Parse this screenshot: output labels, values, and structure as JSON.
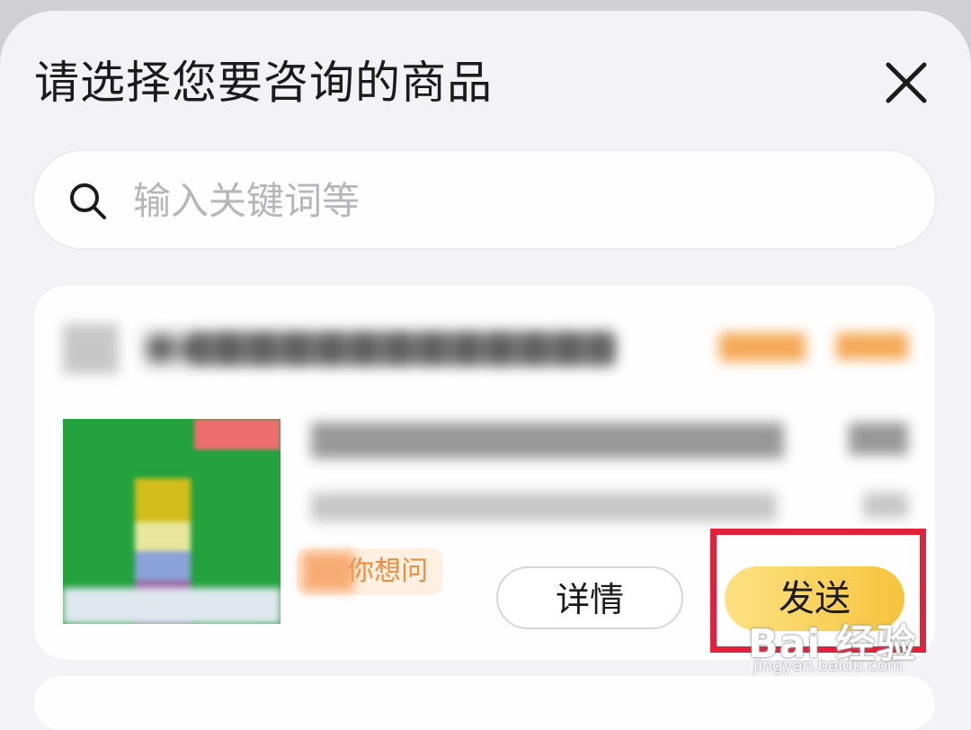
{
  "dialog": {
    "title": "请选择您要咨询的商品",
    "close_icon": "close-icon"
  },
  "search": {
    "placeholder": "输入关键词等",
    "value": "",
    "icon": "search-icon"
  },
  "product_card": {
    "want_ask_tag": "你想问",
    "detail_button": "详情",
    "send_button": "发送"
  },
  "watermark": {
    "brand": "Bai 经验",
    "url": "jingyan.baidu.com"
  },
  "colors": {
    "send_button": "#f6c43c",
    "highlight_box": "#e3213b",
    "want_ask_tag_text": "#f38b3c"
  }
}
